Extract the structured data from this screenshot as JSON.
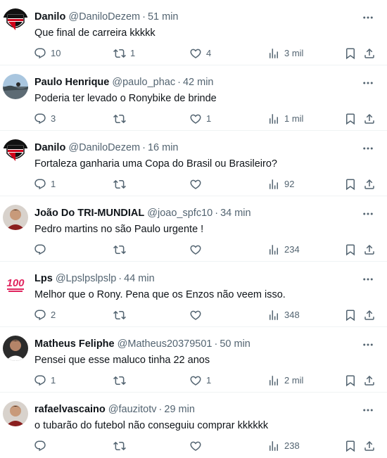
{
  "tweets": [
    {
      "name": "Danilo",
      "handle": "@DaniloDezem",
      "time": "51 min",
      "text": "Que final de carreira kkkkk",
      "replies": "10",
      "retweets": "1",
      "likes": "4",
      "views": "3 mil",
      "avatar": "spfc-crest"
    },
    {
      "name": "Paulo Henrique",
      "handle": "@paulo_phac",
      "time": "42 min",
      "text": "Poderia ter levado o Ronybike de brinde",
      "replies": "3",
      "retweets": "",
      "likes": "1",
      "views": "1 mil",
      "avatar": "landscape-photo"
    },
    {
      "name": "Danilo",
      "handle": "@DaniloDezem",
      "time": "16 min",
      "text": "Fortaleza ganharia uma Copa do Brasil ou Brasileiro?",
      "replies": "1",
      "retweets": "",
      "likes": "",
      "views": "92",
      "avatar": "spfc-crest"
    },
    {
      "name": "João Do TRI-MUNDIAL",
      "handle": "@joao_spfc10",
      "time": "34 min",
      "text": "Pedro martins no são Paulo urgente !",
      "replies": "",
      "retweets": "",
      "likes": "",
      "views": "234",
      "avatar": "person-photo"
    },
    {
      "name": "Lps",
      "handle": "@Lpslpslpslp",
      "time": "44 min",
      "text": "Melhor que o Rony. Pena que os Enzos não veem isso.",
      "replies": "2",
      "retweets": "",
      "likes": "",
      "views": "348",
      "avatar": "100-emoji"
    },
    {
      "name": "Matheus Feliphe",
      "handle": "@Matheus20379501",
      "time": "50 min",
      "text": "Pensei que esse maluco tinha 22 anos",
      "replies": "1",
      "retweets": "",
      "likes": "1",
      "views": "2 mil",
      "avatar": "person-photo-dark"
    },
    {
      "name": "rafaelvascaino",
      "handle": "@fauzitotv",
      "time": "29 min",
      "text": "o tubarão do futebol não conseguiu comprar kkkkkk",
      "replies": "",
      "retweets": "",
      "likes": "",
      "views": "238",
      "avatar": "person-photo"
    }
  ],
  "separator": "·",
  "colors": {
    "text": "#0f1419",
    "secondary": "#536471",
    "divider": "#eff3f4",
    "emoji100": "#e0245e"
  },
  "icons": [
    "reply-icon",
    "retweet-icon",
    "like-icon",
    "views-icon",
    "bookmark-icon",
    "share-icon",
    "more-icon"
  ]
}
